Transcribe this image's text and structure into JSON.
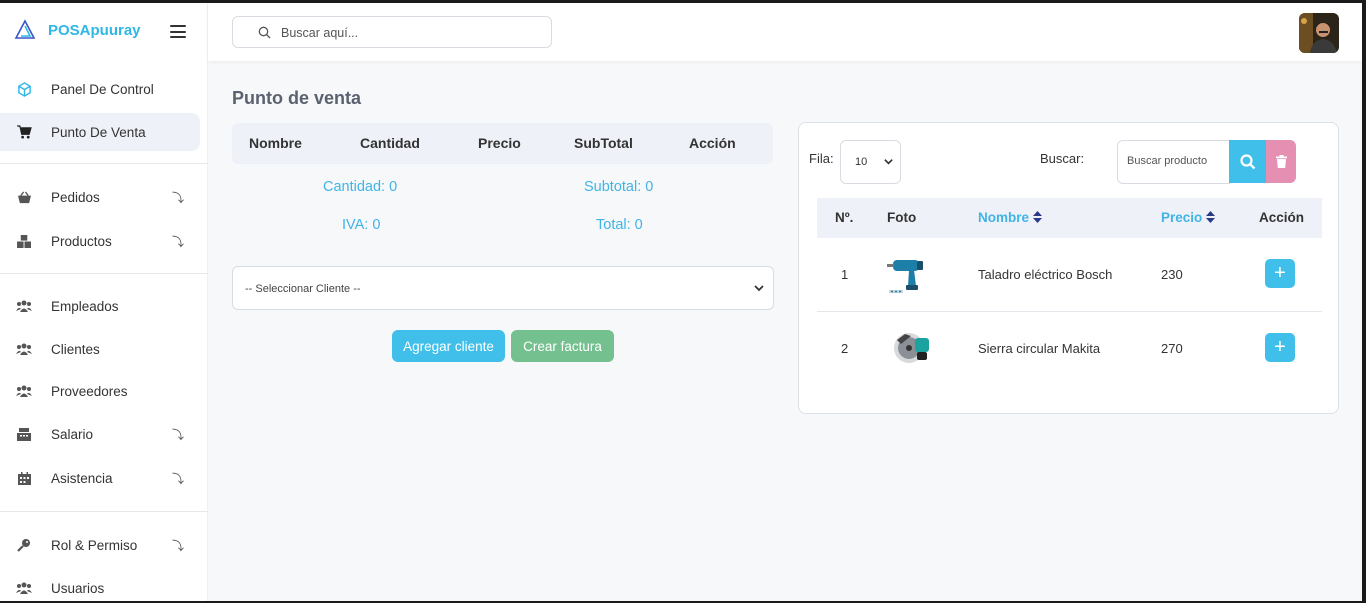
{
  "app": {
    "name": "POSApuuray"
  },
  "colors": {
    "accent": "#41b4e6",
    "primary_button": "#3fbfe9",
    "success_button": "#74c08f",
    "danger_button": "#e58fb3"
  },
  "sidebar": {
    "items": [
      {
        "label": "Panel De Control",
        "icon": "cube-icon",
        "active": false,
        "expandable": false
      },
      {
        "label": "Punto De Venta",
        "icon": "cart-icon",
        "active": true,
        "expandable": false
      },
      {
        "label": "Pedidos",
        "icon": "basket-icon",
        "active": false,
        "expandable": true
      },
      {
        "label": "Productos",
        "icon": "boxes-icon",
        "active": false,
        "expandable": true
      },
      {
        "label": "Empleados",
        "icon": "users-icon",
        "active": false,
        "expandable": false
      },
      {
        "label": "Clientes",
        "icon": "users-icon",
        "active": false,
        "expandable": false
      },
      {
        "label": "Proveedores",
        "icon": "users-icon",
        "active": false,
        "expandable": false
      },
      {
        "label": "Salario",
        "icon": "cash-register-icon",
        "active": false,
        "expandable": true
      },
      {
        "label": "Asistencia",
        "icon": "calendar-icon",
        "active": false,
        "expandable": true
      },
      {
        "label": "Rol & Permiso",
        "icon": "key-icon",
        "active": false,
        "expandable": true
      },
      {
        "label": "Usuarios",
        "icon": "users-icon",
        "active": false,
        "expandable": false
      }
    ]
  },
  "header": {
    "search_placeholder": "Buscar aquí..."
  },
  "page": {
    "title": "Punto de venta"
  },
  "cart": {
    "columns": [
      "Nombre",
      "Cantidad",
      "Precio",
      "SubTotal",
      "Acción"
    ],
    "cantidad": "Cantidad: 0",
    "subtotal": "Subtotal: 0",
    "iva": "IVA: 0",
    "total": "Total: 0",
    "client_select": "-- Seleccionar Cliente --",
    "add_client": "Agregar cliente",
    "create_invoice": "Crear factura"
  },
  "products": {
    "fila_label": "Fila:",
    "fila_value": "10",
    "buscar_label": "Buscar:",
    "buscar_placeholder": "Buscar producto",
    "columns": {
      "num": "Nº.",
      "foto": "Foto",
      "nombre": "Nombre",
      "precio": "Precio",
      "accion": "Acción"
    },
    "rows": [
      {
        "num": "1",
        "nombre": "Taladro eléctrico Bosch",
        "precio": "230"
      },
      {
        "num": "2",
        "nombre": "Sierra circular Makita",
        "precio": "270"
      }
    ]
  }
}
